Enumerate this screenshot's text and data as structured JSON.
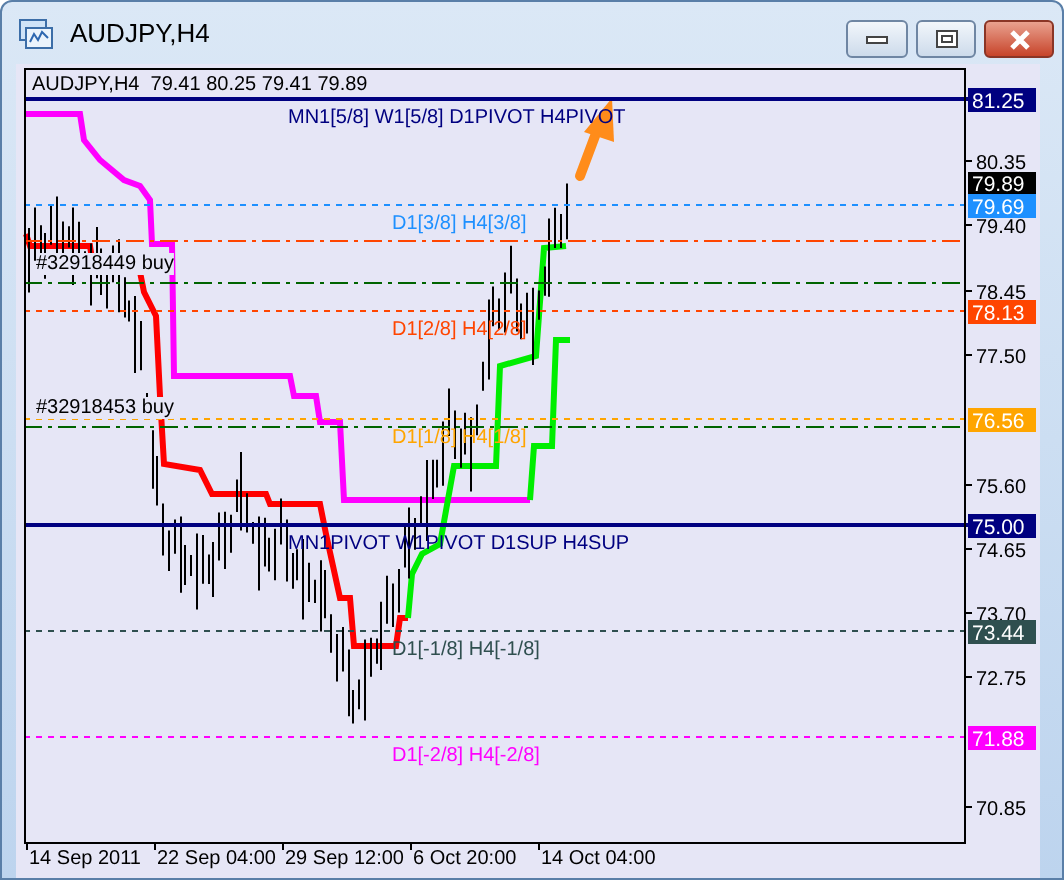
{
  "window": {
    "title": "AUDJPY,H4"
  },
  "chart": {
    "info": "AUDJPY,H4  79.41 80.25 79.41 79.89",
    "bid_tag": "79.89",
    "levels": [
      {
        "kind": "pivot",
        "label": "MN1[5/8] W1[5/8] D1PIVOT H4PIVOT",
        "tag": "81.25",
        "color": "#000080"
      },
      {
        "kind": "octave",
        "label": "D1[3/8] H4[3/8]",
        "tag": "79.69",
        "color": "#1e90ff"
      },
      {
        "kind": "stop"
      },
      {
        "kind": "order",
        "label": "#32918449 buy"
      },
      {
        "kind": "octave",
        "label": "D1[2/8] H4[2/8]",
        "tag": "78.13",
        "color": "#ff4500"
      },
      {
        "kind": "octave",
        "label": "D1[1/8] H4[1/8]",
        "tag": "76.56",
        "color": "#ffa500"
      },
      {
        "kind": "order",
        "label": "#32918453 buy"
      },
      {
        "kind": "pivot",
        "label": "MN1PIVOT W1PIVOT D1SUP H4SUP",
        "tag": "75.00",
        "color": "#000080"
      },
      {
        "kind": "octave",
        "label": "D1[-1/8] H4[-1/8]",
        "tag": "73.44",
        "color": "#2f4f4f"
      },
      {
        "kind": "octave",
        "label": "D1[-2/8] H4[-2/8]",
        "tag": "71.88",
        "color": "#ff00ff"
      }
    ],
    "price_axis": [
      "80.35",
      "79.40",
      "78.45",
      "77.50",
      "75.60",
      "74.65",
      "73.70",
      "72.75",
      "70.85"
    ],
    "time_axis": [
      "14 Sep 2011",
      "22 Sep 04:00",
      "29 Sep 12:00",
      "6 Oct 20:00",
      "14 Oct 04:00"
    ]
  }
}
